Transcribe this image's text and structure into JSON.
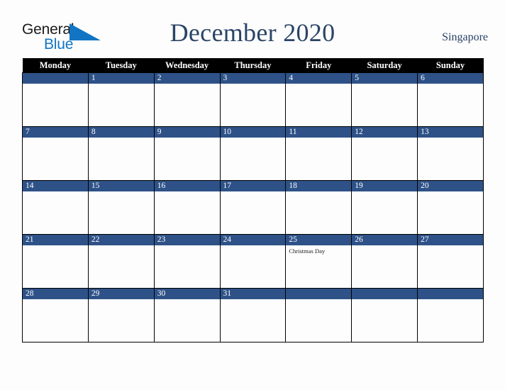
{
  "brand": {
    "name_part1": "General",
    "name_part2": "Blue",
    "triangle_color": "#1175c4",
    "text_color_part1": "#1b1b1b",
    "text_color_part2": "#1175c4"
  },
  "header": {
    "title": "December 2020",
    "region": "Singapore",
    "title_color": "#2b4466"
  },
  "colors": {
    "date_band": "#2e5288",
    "weekday_header_bg": "#000000",
    "weekday_header_text": "#ffffff",
    "cell_bg": "#fdfdfd",
    "grid_line": "#000000",
    "page_bg": "#fdfdfd"
  },
  "weekdays": [
    "Monday",
    "Tuesday",
    "Wednesday",
    "Thursday",
    "Friday",
    "Saturday",
    "Sunday"
  ],
  "weeks": [
    [
      {
        "date": "",
        "events": []
      },
      {
        "date": "1",
        "events": []
      },
      {
        "date": "2",
        "events": []
      },
      {
        "date": "3",
        "events": []
      },
      {
        "date": "4",
        "events": []
      },
      {
        "date": "5",
        "events": []
      },
      {
        "date": "6",
        "events": []
      }
    ],
    [
      {
        "date": "7",
        "events": []
      },
      {
        "date": "8",
        "events": []
      },
      {
        "date": "9",
        "events": []
      },
      {
        "date": "10",
        "events": []
      },
      {
        "date": "11",
        "events": []
      },
      {
        "date": "12",
        "events": []
      },
      {
        "date": "13",
        "events": []
      }
    ],
    [
      {
        "date": "14",
        "events": []
      },
      {
        "date": "15",
        "events": []
      },
      {
        "date": "16",
        "events": []
      },
      {
        "date": "17",
        "events": []
      },
      {
        "date": "18",
        "events": []
      },
      {
        "date": "19",
        "events": []
      },
      {
        "date": "20",
        "events": []
      }
    ],
    [
      {
        "date": "21",
        "events": []
      },
      {
        "date": "22",
        "events": []
      },
      {
        "date": "23",
        "events": []
      },
      {
        "date": "24",
        "events": []
      },
      {
        "date": "25",
        "events": [
          "Christmas Day"
        ]
      },
      {
        "date": "26",
        "events": []
      },
      {
        "date": "27",
        "events": []
      }
    ],
    [
      {
        "date": "28",
        "events": []
      },
      {
        "date": "29",
        "events": []
      },
      {
        "date": "30",
        "events": []
      },
      {
        "date": "31",
        "events": []
      },
      {
        "date": "",
        "events": []
      },
      {
        "date": "",
        "events": []
      },
      {
        "date": "",
        "events": []
      }
    ]
  ]
}
